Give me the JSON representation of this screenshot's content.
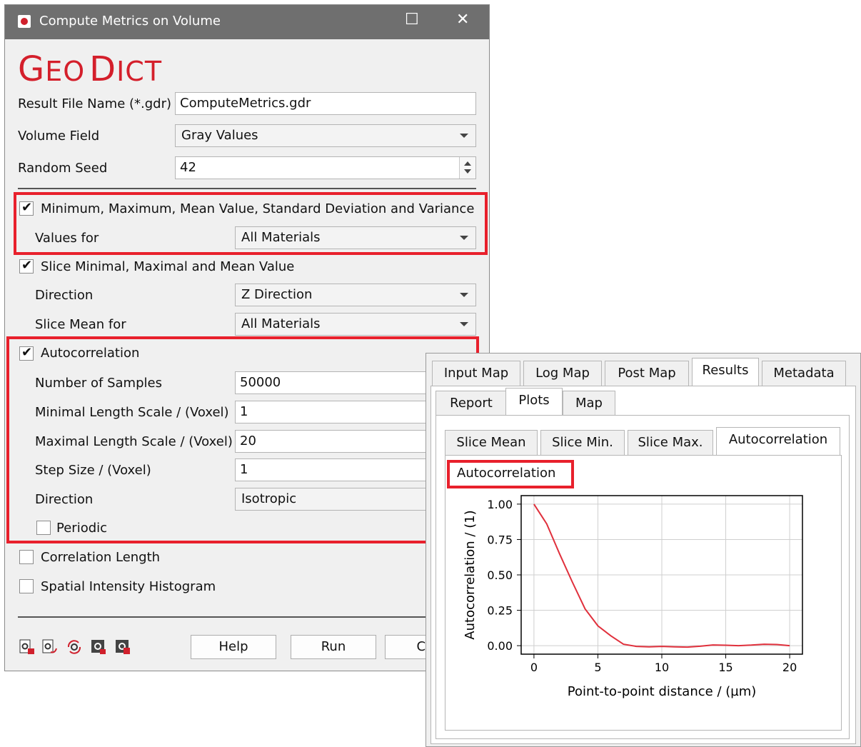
{
  "window": {
    "title": "Compute Metrics on Volume",
    "maximize_glyph": "☐",
    "close_glyph": "✕"
  },
  "brand": {
    "part1_big": "G",
    "part1_small": "EO",
    "part2_big": "D",
    "part2_small": "ICT"
  },
  "form": {
    "result_file_label": "Result File Name (*.gdr)",
    "result_file_value": "ComputeMetrics.gdr",
    "volume_field_label": "Volume Field",
    "volume_field_value": "Gray Values",
    "random_seed_label": "Random Seed",
    "random_seed_value": "42"
  },
  "sections": {
    "minmax": {
      "label": "Minimum, Maximum, Mean Value, Standard Deviation and Variance",
      "checked": true,
      "values_for_label": "Values for",
      "values_for_value": "All Materials"
    },
    "slice": {
      "label": "Slice Minimal, Maximal and Mean Value",
      "checked": true,
      "direction_label": "Direction",
      "direction_value": "Z Direction",
      "slice_mean_label": "Slice Mean for",
      "slice_mean_value": "All Materials"
    },
    "autocorr": {
      "label": "Autocorrelation",
      "checked": true,
      "samples_label": "Number of Samples",
      "samples_value": "50000",
      "min_len_label": "Minimal Length Scale / (Voxel)",
      "min_len_value": "1",
      "max_len_label": "Maximal Length Scale / (Voxel)",
      "max_len_value": "20",
      "step_label": "Step Size / (Voxel)",
      "step_value": "1",
      "direction_label": "Direction",
      "direction_value": "Isotropic",
      "periodic_label": "Periodic"
    },
    "corr_length": {
      "label": "Correlation Length"
    },
    "spatial_hist": {
      "label": "Spatial Intensity Histogram"
    }
  },
  "buttons": {
    "help": "Help",
    "run": "Run",
    "cancel": "Car"
  },
  "toolbar_icons": [
    "gear-export-icon",
    "gear-reload-icon",
    "gear-refresh-icon",
    "gear-script-icon",
    "gear-save-icon"
  ],
  "results": {
    "tabs_top": [
      "Input Map",
      "Log Map",
      "Post Map",
      "Results",
      "Metadata"
    ],
    "tabs_second": [
      "Report",
      "Plots",
      "Map"
    ],
    "tabs_plots": [
      "Slice Mean",
      "Slice Min.",
      "Slice Max.",
      "Autocorrelation"
    ],
    "plot_title": "Autocorrelation"
  },
  "colors": {
    "accent": "#e8202c",
    "brand": "#d41f2b",
    "line": "#e0303c"
  },
  "chart_data": {
    "type": "line",
    "xlabel": "Point-to-point distance / (µm)",
    "ylabel": "Autocorrelation / (1)",
    "xlim": [
      -1,
      21
    ],
    "ylim": [
      -0.06,
      1.06
    ],
    "xticks": [
      0,
      5,
      10,
      15,
      20
    ],
    "yticks": [
      0.0,
      0.25,
      0.5,
      0.75,
      1.0
    ],
    "ytick_labels": [
      "0.00",
      "0.25",
      "0.50",
      "0.75",
      "1.00"
    ],
    "grid": true,
    "series": [
      {
        "x": [
          0,
          1,
          2,
          3,
          4,
          5,
          6,
          7,
          8,
          9,
          10,
          11,
          12,
          13,
          14,
          15,
          16,
          17,
          18,
          19,
          20
        ],
        "y": [
          1.0,
          0.86,
          0.65,
          0.45,
          0.26,
          0.14,
          0.07,
          0.01,
          -0.005,
          -0.008,
          -0.005,
          -0.008,
          -0.01,
          -0.004,
          0.005,
          0.003,
          0.0,
          0.004,
          0.01,
          0.008,
          0.0
        ]
      }
    ]
  }
}
